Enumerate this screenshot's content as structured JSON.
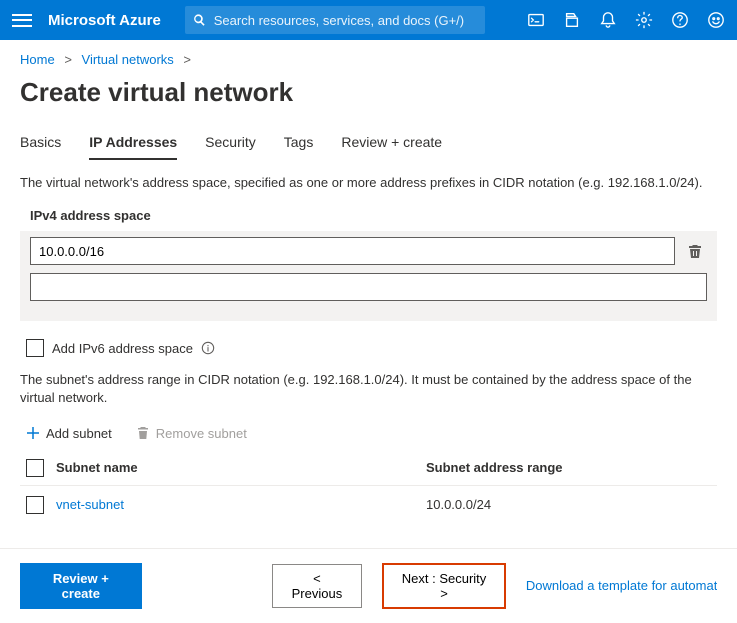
{
  "topbar": {
    "brand": "Microsoft Azure",
    "search_placeholder": "Search resources, services, and docs (G+/)"
  },
  "breadcrumb": {
    "home": "Home",
    "vnets": "Virtual networks"
  },
  "page_title": "Create virtual network",
  "tabs": {
    "basics": "Basics",
    "ip": "IP Addresses",
    "security": "Security",
    "tags": "Tags",
    "review": "Review + create"
  },
  "ipv4": {
    "desc": "The virtual network's address space, specified as one or more address prefixes in CIDR notation (e.g. 192.168.1.0/24).",
    "label": "IPv4 address space",
    "value": "10.0.0.0/16",
    "empty": ""
  },
  "ipv6": {
    "label": "Add IPv6 address space"
  },
  "subnet": {
    "desc": "The subnet's address range in CIDR notation (e.g. 192.168.1.0/24). It must be contained by the address space of the virtual network.",
    "add": "Add subnet",
    "remove": "Remove subnet",
    "header_name": "Subnet name",
    "header_range": "Subnet address range",
    "row0": {
      "name": "vnet-subnet",
      "range": "10.0.0.0/24"
    }
  },
  "footer": {
    "review": "Review + create",
    "prev": "< Previous",
    "next": "Next : Security >",
    "template_link": "Download a template for automation"
  }
}
